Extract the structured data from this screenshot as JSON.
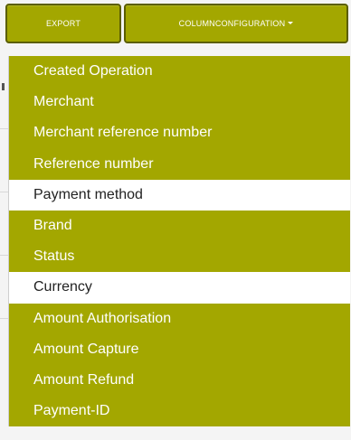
{
  "toolbar": {
    "export_label": "EXPORT",
    "column_config_label": "COLUMNCONFIGURATION"
  },
  "colors": {
    "accent": "#a3a700",
    "accent_border": "#5b5e00",
    "unselected_bg": "#ffffff",
    "selected_text": "#ffffff",
    "unselected_text": "#222222"
  },
  "dropdown": {
    "items": [
      {
        "label": "Created Operation",
        "selected": true
      },
      {
        "label": "Merchant",
        "selected": true
      },
      {
        "label": "Merchant reference number",
        "selected": true
      },
      {
        "label": "Reference number",
        "selected": true
      },
      {
        "label": "Payment method",
        "selected": false
      },
      {
        "label": "Brand",
        "selected": true
      },
      {
        "label": "Status",
        "selected": true
      },
      {
        "label": "Currency",
        "selected": false
      },
      {
        "label": "Amount Authorisation",
        "selected": true
      },
      {
        "label": "Amount Capture",
        "selected": true
      },
      {
        "label": "Amount Refund",
        "selected": true
      },
      {
        "label": "Payment-ID",
        "selected": true
      }
    ]
  }
}
